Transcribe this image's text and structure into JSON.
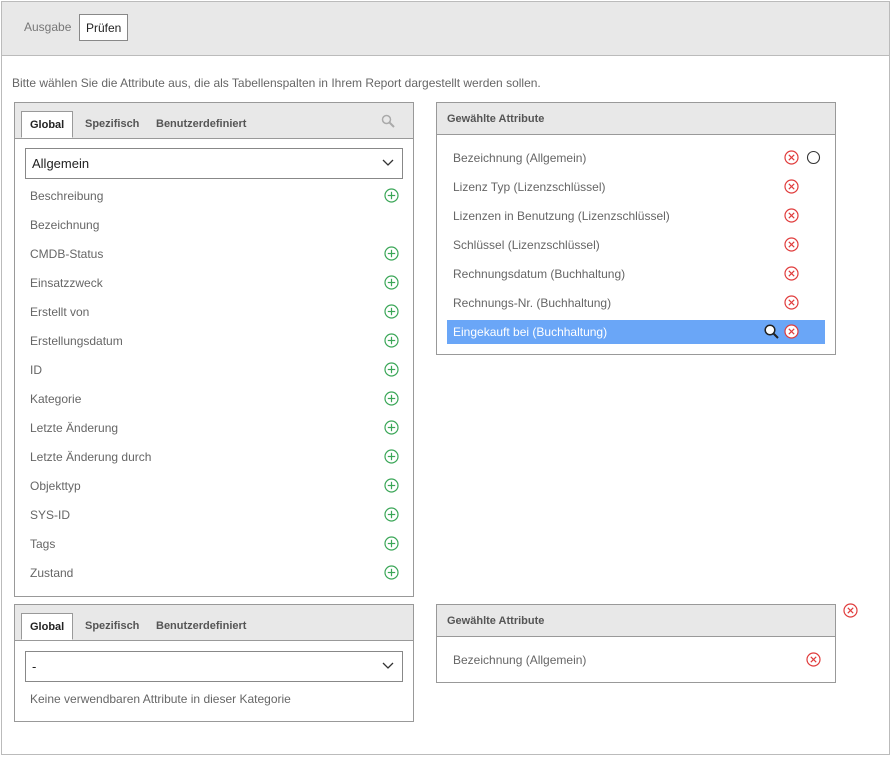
{
  "topbar": {
    "tabs": [
      "Ausgabe",
      "Prüfen"
    ]
  },
  "intro": "Bitte wählen Sie die Attribute aus, die als Tabellenspalten in Ihrem Report dargestellt werden sollen.",
  "panel1": {
    "tabs": [
      "Global",
      "Spezifisch",
      "Benutzerdefiniert"
    ],
    "category": "Allgemein",
    "attributes": [
      {
        "label": "Beschreibung",
        "add": true
      },
      {
        "label": "Bezeichnung",
        "add": false
      },
      {
        "label": "CMDB-Status",
        "add": true
      },
      {
        "label": "Einsatzzweck",
        "add": true
      },
      {
        "label": "Erstellt von",
        "add": true
      },
      {
        "label": "Erstellungsdatum",
        "add": true
      },
      {
        "label": "ID",
        "add": true
      },
      {
        "label": "Kategorie",
        "add": true
      },
      {
        "label": "Letzte Änderung",
        "add": true
      },
      {
        "label": "Letzte Änderung durch",
        "add": true
      },
      {
        "label": "Objekttyp",
        "add": true
      },
      {
        "label": "SYS-ID",
        "add": true
      },
      {
        "label": "Tags",
        "add": true
      },
      {
        "label": "Zustand",
        "add": true
      }
    ]
  },
  "selected1": {
    "title": "Gewählte Attribute",
    "items": [
      "Bezeichnung (Allgemein)",
      "Lizenz Typ (Lizenzschlüssel)",
      "Lizenzen in Benutzung (Lizenzschlüssel)",
      "Schlüssel (Lizenzschlüssel)",
      "Rechnungsdatum (Buchhaltung)",
      "Rechnungs-Nr. (Buchhaltung)",
      "Eingekauft bei (Buchhaltung)"
    ],
    "highlighted_index": 6
  },
  "panel2": {
    "tabs": [
      "Global",
      "Spezifisch",
      "Benutzerdefiniert"
    ],
    "category": "-",
    "empty_text": "Keine verwendbaren Attribute in dieser Kategorie"
  },
  "selected2": {
    "title": "Gewählte Attribute",
    "items": [
      "Bezeichnung (Allgemein)"
    ]
  },
  "colors": {
    "add": "#3aa657",
    "remove": "#e03c3c",
    "highlight": "#6aa6f7"
  }
}
